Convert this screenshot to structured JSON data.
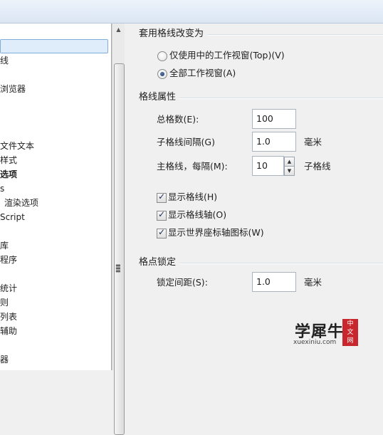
{
  "tree": {
    "items": [
      {
        "label": "线"
      },
      {
        "label": "浏览器"
      },
      {
        "label": "文件文本"
      },
      {
        "label": "样式"
      },
      {
        "label": "选项"
      },
      {
        "label": "s"
      },
      {
        "label": "渲染选项"
      },
      {
        "label": "Script"
      },
      {
        "label": "库"
      },
      {
        "label": "程序"
      },
      {
        "label": "统计"
      },
      {
        "label": "则"
      },
      {
        "label": "列表"
      },
      {
        "label": "辅助"
      },
      {
        "label": "器"
      }
    ]
  },
  "viewport_group": {
    "title": "套用格线改变为",
    "option_current": "仅使用中的工作视窗(Top)(V)",
    "option_all": "全部工作视窗(A)",
    "selected": "all"
  },
  "grid_props": {
    "title": "格线属性",
    "total_label": "总格数(E):",
    "total_value": "100",
    "sub_spacing_label": "子格线间隔(G)",
    "sub_spacing_value": "1.0",
    "sub_spacing_unit": "毫米",
    "major_label": "主格线，每隔(M):",
    "major_value": "10",
    "major_unit": "子格线",
    "show_grid": "显示格线(H)",
    "show_axes": "显示格线轴(O)",
    "show_world_axes_icon": "显示世界座标轴图标(W)"
  },
  "snap_lock": {
    "title": "格点锁定",
    "lock_label": "锁定间距(S):",
    "lock_value": "1.0",
    "lock_unit": "毫米"
  },
  "watermark": {
    "main": "学犀牛",
    "sub": "xuexiniu.com",
    "badge_line1": "中",
    "badge_line2": "文",
    "badge_line3": "网"
  },
  "icons": {
    "check": "✓",
    "spin_up": "▲",
    "spin_down": "▼"
  }
}
